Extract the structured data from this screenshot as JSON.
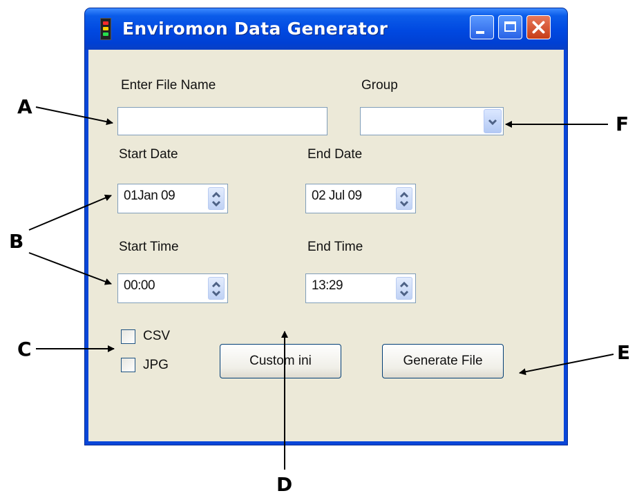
{
  "window": {
    "title": "Enviromon Data Generator"
  },
  "form": {
    "file_name_label": "Enter File Name",
    "file_name_value": "",
    "group_label": "Group",
    "group_value": "",
    "start_date_label": "Start Date",
    "start_date_value": "01Jan 09",
    "end_date_label": "End Date",
    "end_date_value": "02 Jul 09",
    "start_time_label": "Start Time",
    "start_time_value": "00:00",
    "end_time_label": "End Time",
    "end_time_value": "13:29",
    "csv_label": "CSV",
    "jpg_label": "JPG",
    "csv_checked": false,
    "jpg_checked": false,
    "custom_ini_label": "Custom ini",
    "generate_file_label": "Generate File"
  },
  "callouts": {
    "a": "A",
    "b": "B",
    "c": "C",
    "d": "D",
    "e": "E",
    "f": "F"
  }
}
